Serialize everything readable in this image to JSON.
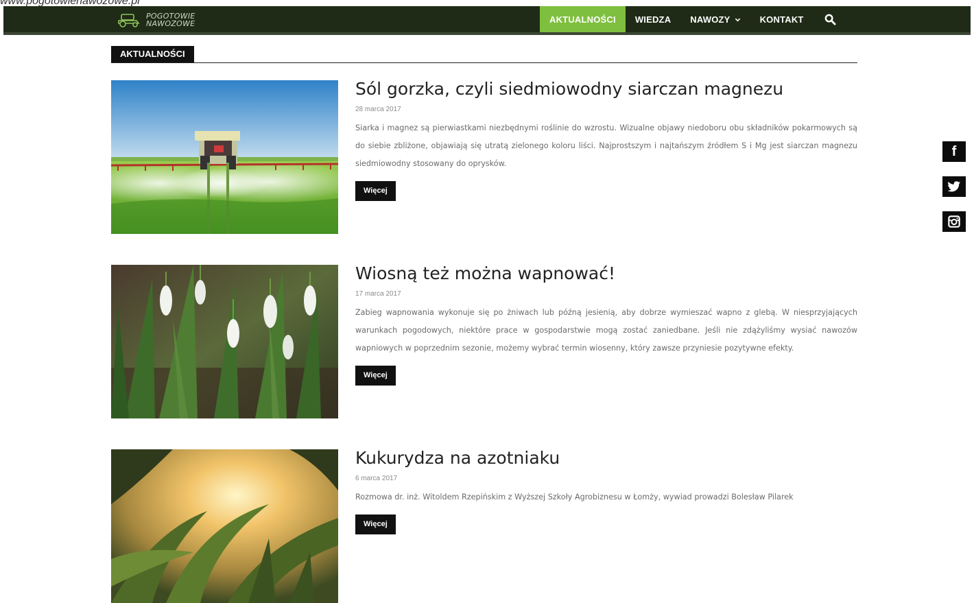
{
  "caption": {
    "url": "www.pogotowienawozowe.pl"
  },
  "brand": {
    "line1": "POGOTOWIE",
    "line2": "NAWOZOWE"
  },
  "nav": {
    "items": [
      {
        "label": "AKTUALNOŚCI",
        "active": true
      },
      {
        "label": "WIEDZA",
        "active": false
      },
      {
        "label": "NAWOZY",
        "active": false,
        "has_dropdown": true
      },
      {
        "label": "KONTAKT",
        "active": false
      }
    ],
    "search_icon": "search-icon",
    "accent_color": "#7fbf3f",
    "bar_color": "#1f2b16"
  },
  "section": {
    "title": "AKTUALNOŚCI"
  },
  "posts": [
    {
      "title": "Sól gorzka, czyli siedmiowodny siarczan magnezu",
      "date": "28 marca 2017",
      "excerpt": "Siarka i magnez są pierwiastkami niezbędnymi roślinie do wzrostu. Wizualne objawy niedoboru obu składników pokarmowych są do siebie zbliżone, objawiają się utratą zielonego koloru liści. Najprostszym i najtańszym źródłem S i Mg jest siarczan magnezu siedmiowodny stosowany do oprysków.",
      "more_label": "Więcej"
    },
    {
      "title": "Wiosną też można wapnować!",
      "date": "17 marca 2017",
      "excerpt": "Zabieg wapnowania wykonuje się po żniwach lub późną jesienią, aby dobrze wymieszać wapno z glebą. W niesprzyjających warunkach pogodowych, niektóre prace w gospodarstwie mogą zostać zaniedbane. Jeśli nie zdążyliśmy wysiać nawozów wapniowych w poprzednim sezonie, możemy wybrać termin wiosenny, który zawsze przyniesie pozytywne efekty.",
      "more_label": "Więcej"
    },
    {
      "title": "Kukurydza na azotniaku",
      "date": "6 marca 2017",
      "excerpt": "Rozmowa dr. inż. Witoldem Rzepińskim z Wyższej Szkoły Agrobiznesu w Łomży, wywiad prowadzi Bolesław Pilarek",
      "more_label": "Więcej"
    }
  ],
  "social": {
    "icons": [
      "facebook-icon",
      "twitter-icon",
      "instagram-icon"
    ],
    "facebook_glyph": "f"
  }
}
